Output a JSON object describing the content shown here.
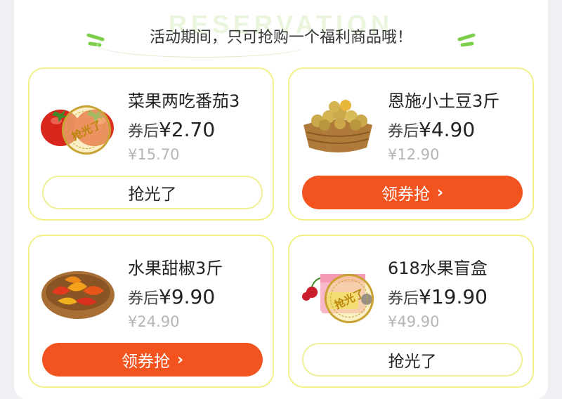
{
  "notice": "活动期间，只可抢购一个福利商品哦！",
  "colors": {
    "accent": "#f3541f",
    "card_border": "#f2f08a",
    "swoosh": "#7ccf4b"
  },
  "products": [
    {
      "title": "菜果两吃番茄3",
      "price_label": "券后",
      "price": "¥2.70",
      "original_price": "¥15.70",
      "button_label": "抢光了",
      "sold_out": true,
      "stamp_label": "抢光了",
      "image_icon": "tomato-icon"
    },
    {
      "title": "恩施小土豆3斤",
      "price_label": "券后",
      "price": "¥4.90",
      "original_price": "¥12.90",
      "button_label": "领券抢",
      "sold_out": false,
      "image_icon": "potato-basket-icon"
    },
    {
      "title": "水果甜椒3斤",
      "price_label": "券后",
      "price": "¥9.90",
      "original_price": "¥24.90",
      "button_label": "领券抢",
      "sold_out": false,
      "image_icon": "pepper-basket-icon"
    },
    {
      "title": "618水果盲盒",
      "price_label": "券后",
      "price": "¥19.90",
      "original_price": "¥49.90",
      "button_label": "抢光了",
      "sold_out": true,
      "stamp_label": "抢光了",
      "image_icon": "fruit-box-icon"
    }
  ]
}
